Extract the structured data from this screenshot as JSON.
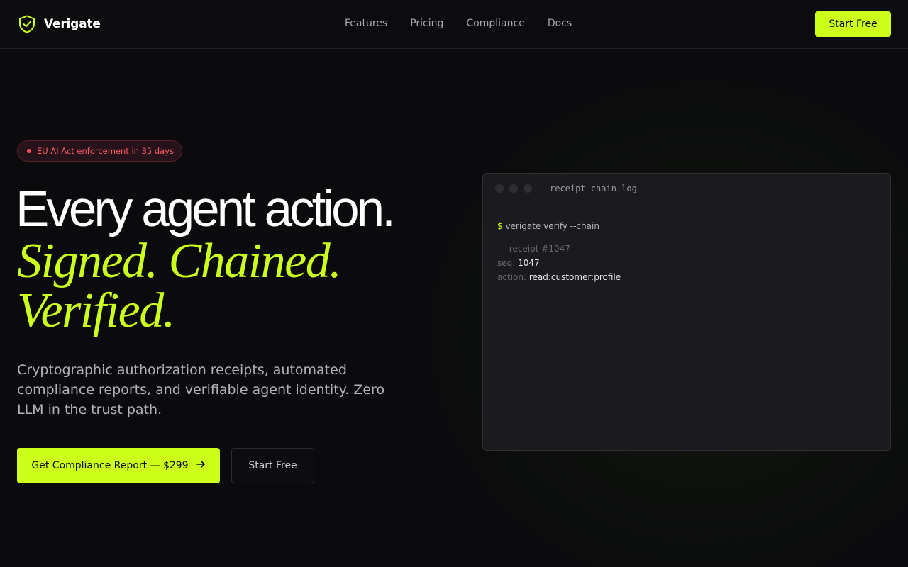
{
  "colors": {
    "background": "#0b0b0d",
    "accent": "#ccff1a",
    "alert": "#ff4d57",
    "terminal_bg": "#1b1b1e"
  },
  "header": {
    "brand_name": "Verigate",
    "brand_icon": "shield-check-icon",
    "nav": [
      {
        "label": "Features"
      },
      {
        "label": "Pricing"
      },
      {
        "label": "Compliance"
      },
      {
        "label": "Docs"
      }
    ],
    "cta_label": "Start Free"
  },
  "hero": {
    "badge_text": "EU AI Act enforcement in 35 days",
    "headline": "Every agent action.",
    "accent_line_1": "Signed. Chained.",
    "accent_line_2": "Verified.",
    "subcopy": "Cryptographic authorization receipts, automated compliance reports, and verifiable agent identity. Zero LLM in the trust path.",
    "primary_cta": "Get Compliance Report — $299",
    "primary_cta_icon": "arrow-right-icon",
    "secondary_cta": "Start Free"
  },
  "terminal": {
    "title": "receipt-chain.log",
    "prompt_symbol": "$",
    "command": "verigate verify --chain",
    "receipt_header": "--- receipt #1047 ---",
    "fields": [
      {
        "key": "seq:",
        "value": "1047"
      },
      {
        "key": "action:",
        "value": "read:customer:profile"
      }
    ],
    "cursor": "_"
  }
}
